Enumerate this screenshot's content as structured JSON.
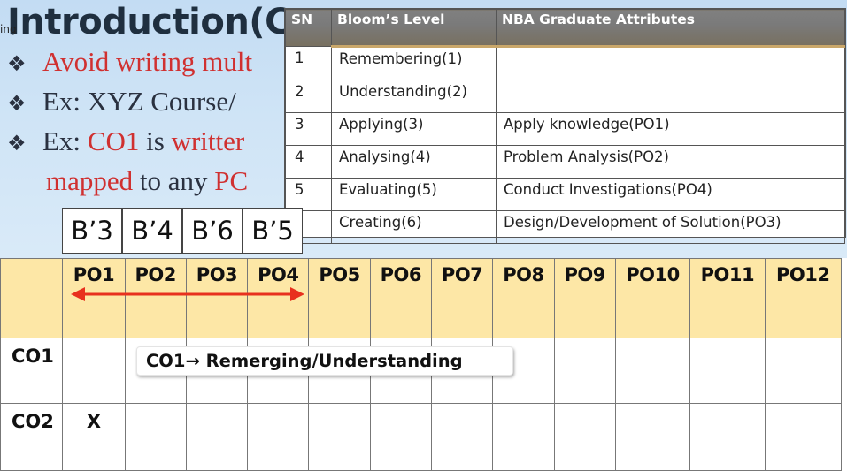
{
  "slide": {
    "title": "Introduction(C",
    "edge_tag": "ing",
    "bullets": [
      {
        "marker": "❖",
        "text_red": "Avoid writing mult",
        "color": "#d03030"
      },
      {
        "marker": "❖",
        "text_dark": "Ex: XYZ Course/"
      },
      {
        "marker": "❖",
        "prefix": "Ex: ",
        "co": "CO1",
        "mid": " is ",
        "red_tail": "writter",
        "cont_red": "mapped",
        "cont_mid": " to any ",
        "cont_red2": "PC"
      }
    ]
  },
  "bloom_table": {
    "headers": [
      "SN",
      "Bloom’s Level",
      "NBA Graduate Attributes"
    ],
    "rows": [
      {
        "sn": "1",
        "level": "Remembering(1)",
        "attribute": ""
      },
      {
        "sn": "2",
        "level": "Understanding(2)",
        "attribute": ""
      },
      {
        "sn": "3",
        "level": "Applying(3)",
        "attribute": "Apply knowledge(PO1)"
      },
      {
        "sn": "4",
        "level": "Analysing(4)",
        "attribute": "Problem Analysis(PO2)"
      },
      {
        "sn": "5",
        "level": "Evaluating(5)",
        "attribute": "Conduct Investigations(PO4)"
      },
      {
        "sn": "",
        "level": "Creating(6)",
        "attribute": "Design/Development of Solution(PO3)"
      }
    ]
  },
  "b_labels": [
    "B’3",
    "B’4",
    "B’6",
    "B’5"
  ],
  "mapping_table": {
    "corner": "",
    "po_headers": [
      "PO1",
      "PO2",
      "PO3",
      "PO4",
      "PO5",
      "PO6",
      "PO7",
      "PO8",
      "PO9",
      "PO10",
      "PO11",
      "PO12"
    ],
    "rows": [
      {
        "co": "CO1",
        "cells": [
          "",
          "",
          "",
          "",
          "",
          "",
          "",
          "",
          "",
          "",
          "",
          ""
        ]
      },
      {
        "co": "CO2",
        "cells": [
          "X",
          "",
          "",
          "",
          "",
          "",
          "",
          "",
          "",
          "",
          "",
          ""
        ]
      }
    ]
  },
  "callout": {
    "prefix": "CO1",
    "arrow": "→",
    "text": " Remerging/Understanding"
  },
  "colors": {
    "header_gold": "#fde7a6",
    "arrow_red": "#e8301e",
    "bullet_red": "#d03030"
  }
}
